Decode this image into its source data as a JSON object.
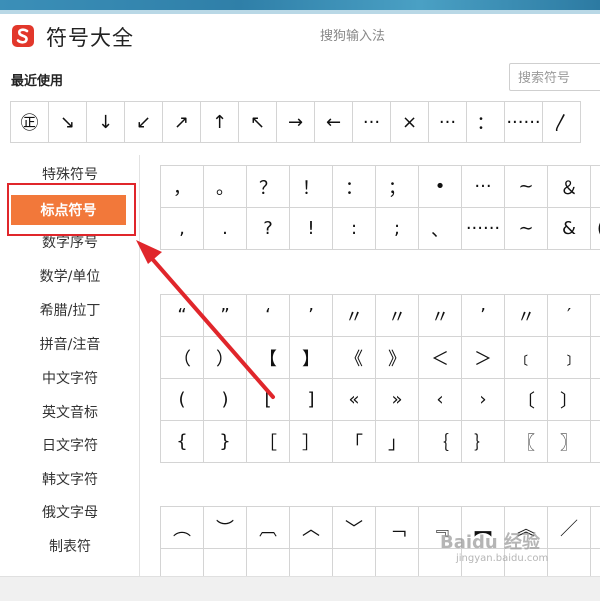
{
  "app": {
    "title": "符号大全",
    "ime_name": "搜狗输入法"
  },
  "recent": {
    "label": "最近使用",
    "search_placeholder": "搜索符号",
    "symbols": [
      "㊣",
      "↘",
      "↓",
      "↙",
      "↗",
      "↑",
      "↖",
      "→",
      "←",
      "···",
      "×",
      "···",
      "：",
      "······",
      "〳"
    ]
  },
  "sidebar": {
    "items": [
      {
        "label": "特殊符号"
      },
      {
        "label": "标点符号",
        "active": true
      },
      {
        "label": "数字序号"
      },
      {
        "label": "数学/单位"
      },
      {
        "label": "希腊/拉丁"
      },
      {
        "label": "拼音/注音"
      },
      {
        "label": "中文字符"
      },
      {
        "label": "英文音标"
      },
      {
        "label": "日文字符"
      },
      {
        "label": "韩文字符"
      },
      {
        "label": "俄文字母"
      },
      {
        "label": "制表符"
      }
    ]
  },
  "grid1": {
    "rows": [
      [
        "，",
        "。",
        "？",
        "！",
        "：",
        "；",
        "•",
        "···",
        "~",
        "＆",
        ""
      ],
      [
        ",",
        ".",
        "?",
        "!",
        ":",
        ";",
        "、",
        "······",
        "∼",
        "&",
        "("
      ]
    ]
  },
  "grid2": {
    "rows": [
      [
        "“",
        "”",
        "‘",
        "’",
        "〃",
        "〃",
        "〃",
        "’",
        "〃",
        "′",
        ""
      ],
      [
        "（",
        "）",
        "【",
        "】",
        "《",
        "》",
        "＜",
        "＞",
        "﹝",
        "﹞",
        ""
      ],
      [
        "(",
        ")",
        "[",
        "]",
        "«",
        "»",
        "‹",
        "›",
        "〔",
        "〕",
        ""
      ],
      [
        "{",
        "}",
        "［",
        "］",
        "「",
        "」",
        "｛",
        "｝",
        "〖",
        "〗",
        ""
      ]
    ]
  },
  "grid3": {
    "rows": [
      [
        "︵",
        "︶",
        "︹",
        "︿",
        "﹀",
        "﹁",
        "﹃",
        "︻",
        "︽",
        "／",
        ""
      ],
      [
        "",
        "",
        "",
        "",
        "",
        "",
        "",
        "",
        "",
        "",
        ""
      ]
    ]
  },
  "watermark": {
    "text": "Baidu 经验",
    "url_text": "jingyan.baidu.com"
  },
  "colors": {
    "accent": "#f2783a",
    "annotation": "#e0262b",
    "logo": "#e2372b"
  }
}
